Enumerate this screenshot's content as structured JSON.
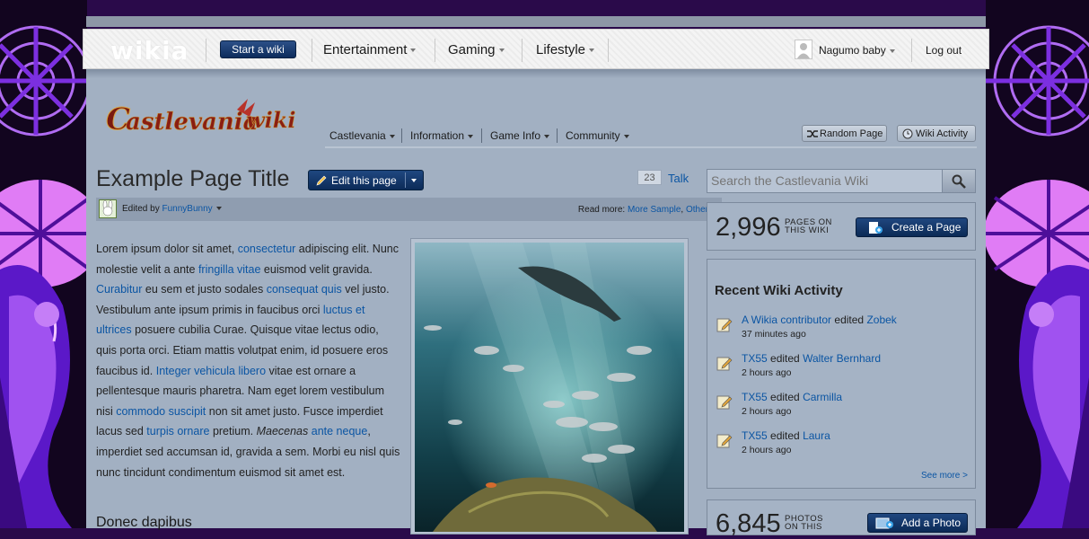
{
  "global_nav": {
    "logo": "wikia",
    "start_wiki": "Start a wiki",
    "menus": [
      "Entertainment",
      "Gaming",
      "Lifestyle"
    ],
    "user": "Nagumo baby",
    "logout": "Log out"
  },
  "wiki_header": {
    "logo_text": "Castlevania Wiki",
    "nav": [
      "Castlevania",
      "Information",
      "Game Info",
      "Community"
    ],
    "random_page": "Random Page",
    "wiki_activity": "Wiki Activity"
  },
  "article": {
    "title": "Example Page Title",
    "edit_label": "Edit this page",
    "comment_count": "23",
    "talk": "Talk",
    "edited_by_label": "Edited by",
    "edited_by_user": "FunnyBunny",
    "read_more_label": "Read more:",
    "read_more_1": "More Sample",
    "read_more_2": "Others",
    "subheading": "Donec dapibus"
  },
  "rail": {
    "search_placeholder": "Search the Castlevania Wiki",
    "pages_count": "2,996",
    "pages_label_1": "PAGES ON",
    "pages_label_2": "THIS WIKI",
    "create_page": "Create a Page",
    "activity_title": "Recent Wiki Activity",
    "activity": [
      {
        "user": "A Wikia contributor",
        "action": "edited",
        "page": "Zobek",
        "time": "37 minutes ago"
      },
      {
        "user": "TX55",
        "action": "edited",
        "page": "Walter Bernhard",
        "time": "2 hours ago"
      },
      {
        "user": "TX55",
        "action": "edited",
        "page": "Carmilla",
        "time": "2 hours ago"
      },
      {
        "user": "TX55",
        "action": "edited",
        "page": "Laura",
        "time": "2 hours ago"
      }
    ],
    "see_more": "See more >",
    "photos_count": "6,845",
    "photos_label_1": "PHOTOS",
    "photos_label_2": "ON THIS",
    "add_photo": "Add a Photo"
  },
  "colors": {
    "page_bg": "#a2b0c2",
    "link": "#0b55a3",
    "button": "#0c2b58",
    "background_purple": "#7a2ad8"
  }
}
